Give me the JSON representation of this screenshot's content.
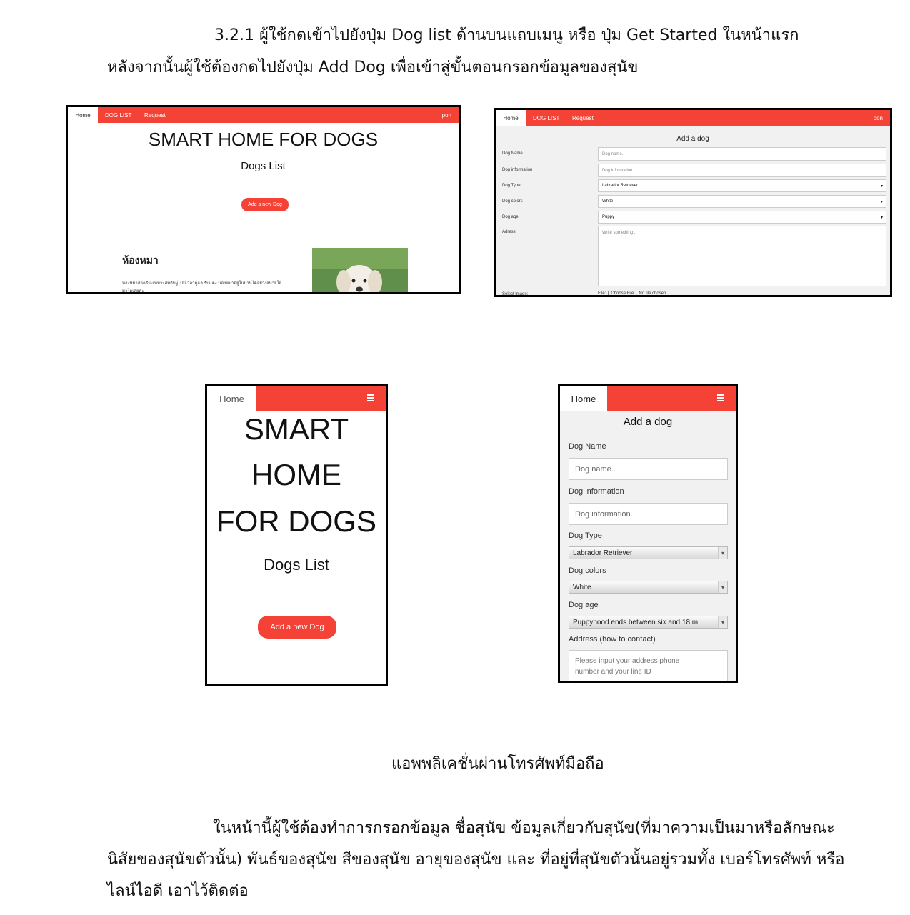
{
  "doc": {
    "intro_line1": "3.2.1 ผู้ใช้กดเข้าไปยังปุ่ม Dog list ด้านบนแถบเมนู หรือ ปุ่ม Get Started ในหน้าแรก",
    "intro_line2": "หลังจากนั้นผู้ใช้ต้องกดไปยังปุ่ม Add Dog เพื่อเข้าสู่ขั้นตอนกรอกข้อมูลของสุนัข",
    "caption": "แอพพลิเคชั่นผ่านโทรศัพท์มือถือ",
    "body_line1": "ในหน้านี้ผู้ใช้ต้องทำการกรอกข้อมูล ชื่อสุนัข ข้อมูลเกี่ยวกับสุนัข(ที่มาความเป็นมาหรือลักษณะ",
    "body_line2": "นิสัยของสุนัขตัวนั้น) พันธ์ของสุนัข สีของสุนัข อายุของสุนัข และ ที่อยู่ที่สุนัขตัวนั้นอยู่รวมทั้ง เบอร์โทรศัพท์ หรือ",
    "body_line3": "ไลน์ไอดี เอาไว้ติดต่อ"
  },
  "desktop_home": {
    "nav_home": "Home",
    "nav_dog_list": "DOG LIST",
    "nav_request": "Request",
    "nav_user": "pon",
    "title": "SMART HOME FOR DOGS",
    "subtitle": "Dogs List",
    "add_button": "Add a new Dog",
    "room_title": "ห้องหมา",
    "room_text_1": "ห้องหมาอัจฉริยะเหมาะสมกับผู้ไม่มีเวลาดูแล รับแต่ง น้องหมาอยู่ในบ้านได้อย่างสบายใจ",
    "room_text_2": "มาได้เลยค่ะ"
  },
  "desktop_add": {
    "nav_home": "Home",
    "nav_dog_list": "DOG LIST",
    "nav_request": "Request",
    "nav_user": "pon",
    "title": "Add a dog",
    "label_name": "Dog Name",
    "label_info": "Dog information",
    "label_type": "Dog Type",
    "label_colors": "Dog colors",
    "label_age": "Dog age",
    "label_address": "Adress",
    "label_image": "Select image:",
    "ph_name": "Dog name..",
    "ph_info": "Dog information..",
    "val_type": "Labrador Retriever",
    "val_colors": "White",
    "val_age": "Puppy",
    "ph_address": "Write something..",
    "file_label": "File:",
    "file_button": "Choose File",
    "file_status": "No file chosen"
  },
  "mobile_home": {
    "nav_home": "Home",
    "title_1": "SMART",
    "title_2": "HOME",
    "title_3": "FOR DOGS",
    "subtitle": "Dogs List",
    "add_button": "Add a new Dog"
  },
  "mobile_add": {
    "nav_home": "Home",
    "title": "Add a dog",
    "label_name": "Dog Name",
    "ph_name": "Dog name..",
    "label_info": "Dog information",
    "ph_info": "Dog information..",
    "label_type": "Dog Type",
    "val_type": "Labrador Retriever",
    "label_colors": "Dog colors",
    "val_colors": "White",
    "label_age": "Dog age",
    "val_age": "Puppyhood ends between six and 18 m",
    "label_address": "Address (how to contact)",
    "ph_address_1": "Please input your address phone",
    "ph_address_2": "number and your line ID"
  },
  "colors": {
    "accent": "#f44336"
  },
  "icons": {
    "menu": "hamburger-icon",
    "dropdown": "chevron-down-icon"
  }
}
